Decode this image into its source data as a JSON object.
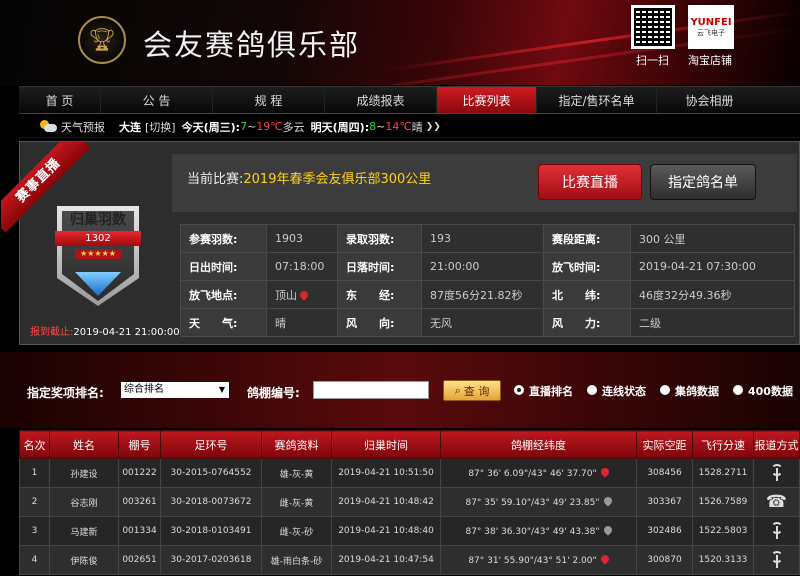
{
  "header": {
    "site_title": "会友赛鸽俱乐部",
    "qr_label": "扫一扫",
    "shop_label": "淘宝店铺",
    "shop_brand": "YUNFEI",
    "shop_brand_sub": "云飞电子"
  },
  "nav": {
    "items": [
      {
        "label": "首 页",
        "active": false
      },
      {
        "label": "公 告",
        "active": false
      },
      {
        "label": "规 程",
        "active": false
      },
      {
        "label": "成绩报表",
        "active": false
      },
      {
        "label": "比赛列表",
        "active": true
      },
      {
        "label": "指定/售环名单",
        "active": false
      },
      {
        "label": "协会相册",
        "active": false
      }
    ]
  },
  "weather": {
    "label": "天气预报",
    "city": "大连",
    "switch": "[切换]",
    "today": "今天(周三):",
    "today_low": "7",
    "today_high": "19℃",
    "today_cond": "多云",
    "tomorrow": "明天(周四):",
    "tomorrow_low": "8",
    "tomorrow_high": "14℃",
    "tomorrow_cond": "晴"
  },
  "live": {
    "ribbon": "赛事直播",
    "badge_title": "归巢羽数",
    "badge_count": "1302",
    "badge_stars": "★★★★★",
    "deadline_label": "报到截止:",
    "deadline_value": "2019-04-21 21:00:00",
    "race_prefix": "当前比赛:",
    "race_name": "2019年春季会友俱乐部300公里",
    "btn_live": "比赛直播",
    "btn_list": "指定鸽名单",
    "info": [
      [
        "参赛羽数:",
        "1903",
        "录取羽数:",
        "193",
        "赛段距离:",
        "300 公里"
      ],
      [
        "日出时间:",
        "07:18:00",
        "日落时间:",
        "21:00:00",
        "放飞时间:",
        "2019-04-21 07:30:00"
      ],
      [
        "放飞地点:",
        "顶山",
        "东　　经:",
        "87度56分21.82秒",
        "北　　纬:",
        "46度32分49.36秒"
      ],
      [
        "天　　气:",
        "晴",
        "风　　向:",
        "无风",
        "风　　力:",
        "二级"
      ]
    ]
  },
  "search": {
    "award_label": "指定奖项排名:",
    "award_value": "综合排名",
    "loft_label": "鸽棚编号:",
    "loft_value": "",
    "query_btn": "查 询",
    "options": [
      {
        "label": "直播排名",
        "on": true
      },
      {
        "label": "连线状态",
        "on": false
      },
      {
        "label": "集鸽数据",
        "on": false
      },
      {
        "label": "400数据",
        "on": false
      }
    ]
  },
  "results": {
    "headers": [
      "名次",
      "姓名",
      "棚号",
      "足环号",
      "赛鸽资料",
      "归巢时间",
      "鸽棚经纬度",
      "实际空距",
      "飞行分速",
      "报道方式"
    ],
    "rows": [
      {
        "rank": "1",
        "name": "孙建设",
        "loft": "001222",
        "ring": "30-2015-0764552",
        "info": "雄-灰-黄",
        "time": "2019-04-21 10:51:50",
        "coord": "87° 36' 6.09\"/43° 46' 37.70\"",
        "marker": "red",
        "dist": "308456",
        "speed": "1528.2711",
        "report": "tower"
      },
      {
        "rank": "2",
        "name": "谷志刚",
        "loft": "003261",
        "ring": "30-2018-0073672",
        "info": "雌-灰-黄",
        "time": "2019-04-21 10:48:42",
        "coord": "87° 35' 59.10\"/43° 49' 23.85\"",
        "marker": "grey",
        "dist": "303367",
        "speed": "1526.7589",
        "report": "phone"
      },
      {
        "rank": "3",
        "name": "马建新",
        "loft": "001334",
        "ring": "30-2018-0103491",
        "info": "雌-灰-砂",
        "time": "2019-04-21 10:48:40",
        "coord": "87° 38' 36.30\"/43° 49' 43.38\"",
        "marker": "grey",
        "dist": "302486",
        "speed": "1522.5803",
        "report": "tower"
      },
      {
        "rank": "4",
        "name": "伊陈俊",
        "loft": "002651",
        "ring": "30-2017-0203618",
        "info": "雄-雨白条-砂",
        "time": "2019-04-21 10:47:54",
        "coord": "87° 31' 55.90\"/43° 51' 2.00\"",
        "marker": "red",
        "dist": "300870",
        "speed": "1520.3133",
        "report": "tower"
      }
    ]
  }
}
